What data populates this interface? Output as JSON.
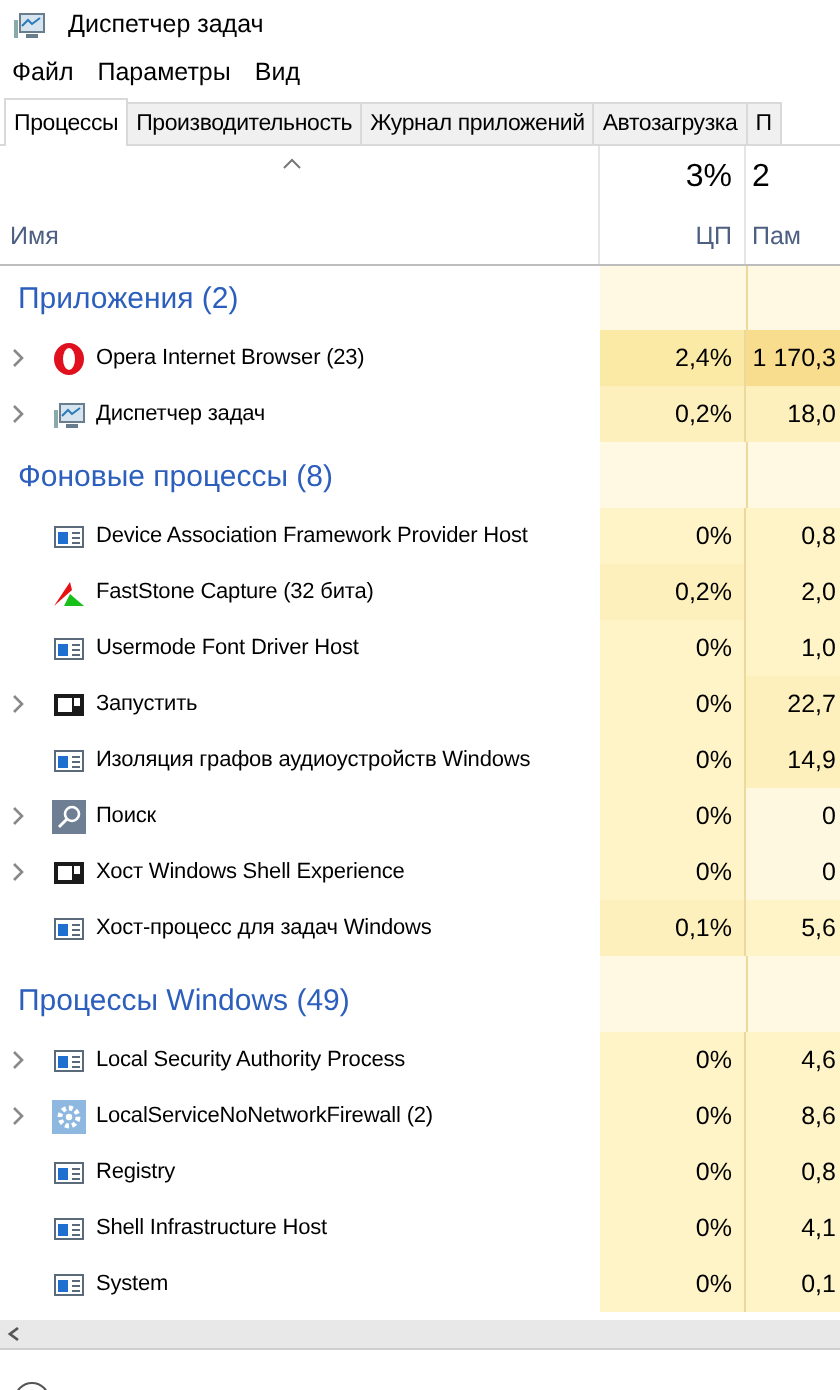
{
  "window": {
    "title": "Диспетчер задач"
  },
  "menu": [
    "Файл",
    "Параметры",
    "Вид"
  ],
  "tabs": [
    {
      "label": "Процессы",
      "selected": true
    },
    {
      "label": "Производительность",
      "selected": false
    },
    {
      "label": "Журнал приложений",
      "selected": false
    },
    {
      "label": "Автозагрузка",
      "selected": false
    },
    {
      "label": "П",
      "selected": false
    }
  ],
  "table": {
    "columns": [
      {
        "label": "Имя"
      },
      {
        "label": "ЦП",
        "total": "3%"
      },
      {
        "label": "Пам",
        "total": "2"
      }
    ],
    "groups": [
      {
        "title": "Приложения (2)",
        "rows": [
          {
            "name": "Opera Internet Browser (23)",
            "kind": "opera",
            "expandable": true,
            "cpu": {
              "text": "2,4%",
              "color": "#fbe9a6"
            },
            "memory": {
              "text": "1 170,3",
              "color": "#f9dd8e"
            }
          },
          {
            "name": "Диспетчер задач",
            "kind": "monitor",
            "expandable": true,
            "cpu": {
              "text": "0,2%",
              "color": "#fdf0bd"
            },
            "memory": {
              "text": "18,0",
              "color": "#fdf0bd"
            }
          }
        ]
      },
      {
        "title": "Фоновые процессы (8)",
        "rows": [
          {
            "name": "Device Association Framework Provider Host",
            "kind": "window",
            "expandable": false,
            "cpu": {
              "text": "0%",
              "color": "#fff4c8"
            },
            "memory": {
              "text": "0,8",
              "color": "#fff4c8"
            }
          },
          {
            "name": "FastStone Capture (32 бита)",
            "kind": "faststone",
            "expandable": false,
            "cpu": {
              "text": "0,2%",
              "color": "#fdf0bd"
            },
            "memory": {
              "text": "2,0",
              "color": "#fff4c8"
            }
          },
          {
            "name": "Usermode Font Driver Host",
            "kind": "window",
            "expandable": false,
            "cpu": {
              "text": "0%",
              "color": "#fff4c8"
            },
            "memory": {
              "text": "1,0",
              "color": "#fff4c8"
            }
          },
          {
            "name": "Запустить",
            "kind": "dark",
            "expandable": true,
            "cpu": {
              "text": "0%",
              "color": "#fff4c8"
            },
            "memory": {
              "text": "22,7",
              "color": "#fdf0bd"
            }
          },
          {
            "name": "Изоляция графов аудиоустройств Windows",
            "kind": "window",
            "expandable": false,
            "cpu": {
              "text": "0%",
              "color": "#fff4c8"
            },
            "memory": {
              "text": "14,9",
              "color": "#fdf0bd"
            }
          },
          {
            "name": "Поиск",
            "kind": "search",
            "expandable": true,
            "cpu": {
              "text": "0%",
              "color": "#fff4c8"
            },
            "memory": {
              "text": "0",
              "color": "#fff8e0"
            }
          },
          {
            "name": "Хост Windows Shell Experience",
            "kind": "dark",
            "expandable": true,
            "cpu": {
              "text": "0%",
              "color": "#fff4c8"
            },
            "memory": {
              "text": "0",
              "color": "#fff8e0"
            }
          },
          {
            "name": "Хост-процесс для задач Windows",
            "kind": "window",
            "expandable": false,
            "cpu": {
              "text": "0,1%",
              "color": "#fdf0bd"
            },
            "memory": {
              "text": "5,6",
              "color": "#fff4c8"
            }
          }
        ]
      },
      {
        "title": "Процессы Windows (49)",
        "rows": [
          {
            "name": "Local Security Authority Process",
            "kind": "window",
            "expandable": true,
            "cpu": {
              "text": "0%",
              "color": "#fff4c8"
            },
            "memory": {
              "text": "4,6",
              "color": "#fff4c8"
            }
          },
          {
            "name": "LocalServiceNoNetworkFirewall (2)",
            "kind": "gear",
            "expandable": true,
            "cpu": {
              "text": "0%",
              "color": "#fff4c8"
            },
            "memory": {
              "text": "8,6",
              "color": "#fff4c8"
            }
          },
          {
            "name": "Registry",
            "kind": "window",
            "expandable": false,
            "cpu": {
              "text": "0%",
              "color": "#fff4c8"
            },
            "memory": {
              "text": "0,8",
              "color": "#fff4c8"
            }
          },
          {
            "name": "Shell Infrastructure Host",
            "kind": "window",
            "expandable": false,
            "cpu": {
              "text": "0%",
              "color": "#fff4c8"
            },
            "memory": {
              "text": "4,1",
              "color": "#fff4c8"
            }
          },
          {
            "name": "System",
            "kind": "window",
            "expandable": false,
            "cpu": {
              "text": "0%",
              "color": "#fff4c8"
            },
            "memory": {
              "text": "0,1",
              "color": "#fff4c8"
            }
          }
        ]
      }
    ]
  }
}
